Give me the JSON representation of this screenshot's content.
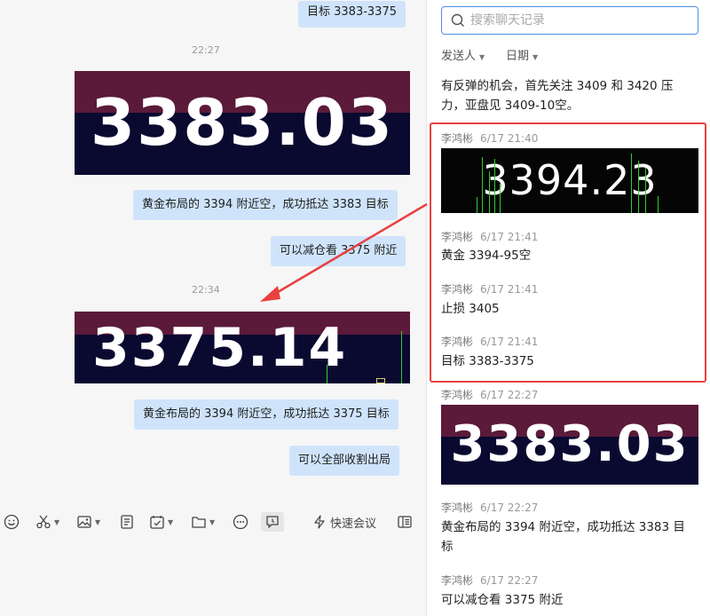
{
  "chat": {
    "messages": [
      {
        "text": "目标 3383-3375"
      },
      {
        "text": "黄金布局的 3394 附近空，成功抵达 3383 目标"
      },
      {
        "text": "可以减仓看 3375 附近"
      },
      {
        "text": "黄金布局的 3394 附近空，成功抵达 3375 目标"
      },
      {
        "text": "可以全部收割出局"
      }
    ],
    "timestamps": [
      "22:27",
      "22:34"
    ],
    "quotes": [
      "3383.03",
      "3375.14"
    ]
  },
  "toolbar": {
    "icons": [
      "smiley-icon",
      "scissors-icon",
      "image-icon",
      "document-icon",
      "calendar-check-icon",
      "folder-icon",
      "more-icon",
      "chat-record-icon",
      "lightning-icon",
      "sidebar-icon"
    ],
    "meeting_label": "快速会议"
  },
  "side": {
    "search_placeholder": "搜索聊天记录",
    "filter_sender": "发送人",
    "filter_date": "日期",
    "top_text": "有反弹的机会，首先关注 3409 和 3420 压力，亚盘见 3409-10空。",
    "records": [
      {
        "sender": "李鸿彬",
        "time": "6/17 21:40",
        "quote": "3394.23"
      },
      {
        "sender": "李鸿彬",
        "time": "6/17 21:41",
        "text": "黄金 3394-95空"
      },
      {
        "sender": "李鸿彬",
        "time": "6/17 21:41",
        "text": "止损 3405"
      },
      {
        "sender": "李鸿彬",
        "time": "6/17 21:41",
        "text": "目标 3383-3375"
      },
      {
        "sender": "李鸿彬",
        "time": "6/17 22:27",
        "quote": "3383.03"
      },
      {
        "sender": "李鸿彬",
        "time": "6/17 22:27",
        "text": "黄金布局的 3394 附近空，成功抵达 3383 目标"
      },
      {
        "sender": "李鸿彬",
        "time": "6/17 22:27",
        "text": "可以减仓看 3375 附近"
      }
    ]
  },
  "colors": {
    "bubble": "#cfe4fb",
    "quote_top": "#5b1a3a",
    "quote_bottom": "#0a0930",
    "highlight": "#e94040",
    "search_border": "#4d8fe8"
  }
}
